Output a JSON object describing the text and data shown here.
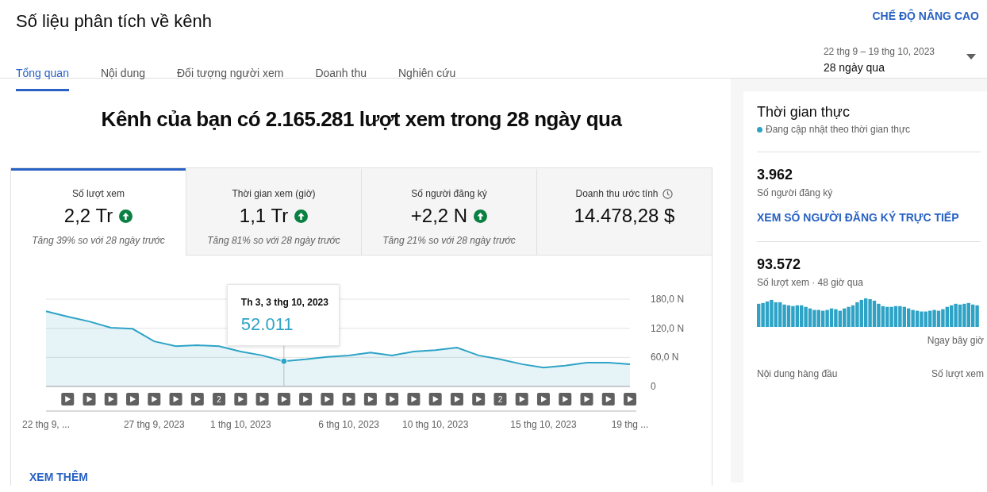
{
  "header": {
    "title": "Số liệu phân tích về kênh",
    "advanced_mode": "CHẾ ĐỘ NÂNG CAO"
  },
  "tabs": [
    {
      "label": "Tổng quan",
      "selected": true
    },
    {
      "label": "Nội dung",
      "selected": false
    },
    {
      "label": "Đối tượng người xem",
      "selected": false
    },
    {
      "label": "Doanh thu",
      "selected": false
    },
    {
      "label": "Nghiên cứu",
      "selected": false
    }
  ],
  "date_range": {
    "dates": "22 thg 9 – 19 thg 10, 2023",
    "period": "28 ngày qua"
  },
  "headline": "Kênh của bạn có 2.165.281 lượt xem trong 28 ngày qua",
  "metrics": [
    {
      "label": "Số lượt xem",
      "value": "2,2 Tr",
      "trend_up": true,
      "note": "Tăng 39% so với 28 ngày trước",
      "info": false,
      "selected": true
    },
    {
      "label": "Thời gian xem (giờ)",
      "value": "1,1 Tr",
      "trend_up": true,
      "note": "Tăng 81% so với 28 ngày trước",
      "info": false,
      "selected": false
    },
    {
      "label": "Số người đăng ký",
      "value": "+2,2 N",
      "trend_up": true,
      "note": "Tăng 21% so với 28 ngày trước",
      "info": false,
      "selected": false
    },
    {
      "label": "Doanh thu ước tính",
      "value": "14.478,28 $",
      "trend_up": false,
      "info": true,
      "selected": false
    }
  ],
  "chart": {
    "tooltip_date": "Th 3, 3 thg 10, 2023",
    "chart_data": {
      "type": "area",
      "categories": [
        "22 thg 9, ...",
        null,
        null,
        null,
        null,
        "27 thg 9, 2023",
        null,
        null,
        null,
        "1 thg 10, 2023",
        null,
        null,
        null,
        null,
        "6 thg 10, 2023",
        null,
        null,
        null,
        "10 thg 10, 2023",
        null,
        null,
        null,
        null,
        "15 thg 10, 2023",
        null,
        null,
        null,
        "19 thg ..."
      ],
      "series": [
        {
          "color": "#2ea3c6",
          "values": [
            155,
            144,
            134,
            121,
            119,
            93,
            83,
            85,
            83,
            72,
            64,
            52,
            56,
            61,
            64,
            70,
            64,
            72,
            75,
            80,
            64,
            56,
            46,
            39,
            43,
            49,
            49,
            46
          ]
        }
      ],
      "ylim": [
        0,
        180
      ],
      "yticks": [
        {
          "value": 0,
          "label": "0"
        },
        {
          "value": 60,
          "label": "60,0 N"
        },
        {
          "value": 120,
          "label": "120,0 N"
        },
        {
          "value": 180,
          "label": "180,0 N"
        }
      ],
      "annotations": [
        {
          "y": 52,
          "text": "52.011"
        }
      ]
    },
    "markers": [
      {
        "kind": "video"
      },
      {
        "kind": "video"
      },
      {
        "kind": "video"
      },
      {
        "kind": "video"
      },
      {
        "kind": "video"
      },
      {
        "kind": "video"
      },
      {
        "kind": "video"
      },
      {
        "kind": "count",
        "count": "2"
      },
      {
        "kind": "video"
      },
      {
        "kind": "video"
      },
      {
        "kind": "video"
      },
      {
        "kind": "video"
      },
      {
        "kind": "video"
      },
      {
        "kind": "video"
      },
      {
        "kind": "video"
      },
      {
        "kind": "video"
      },
      {
        "kind": "video"
      },
      {
        "kind": "video"
      },
      {
        "kind": "video"
      },
      {
        "kind": "video"
      },
      {
        "kind": "count",
        "count": "2"
      },
      {
        "kind": "video"
      },
      {
        "kind": "video"
      },
      {
        "kind": "video"
      },
      {
        "kind": "video"
      },
      {
        "kind": "video"
      },
      {
        "kind": "video"
      }
    ],
    "see_more": "XEM THÊM"
  },
  "realtime": {
    "title": "Thời gian thực",
    "status": "Đang cập nhật theo thời gian thực",
    "subscribers": "3.962",
    "subscribers_label": "Số người đăng ký",
    "live_link": "XEM SỐ NGƯỜI ĐĂNG KÝ TRỰC TIẾP",
    "views": "93.572",
    "views_label": "Số lượt xem · 48 giờ qua",
    "now_label": "Ngay bây giờ",
    "top_content": "Nội dung hàng đầu",
    "top_views": "Số lượt xem"
  }
}
